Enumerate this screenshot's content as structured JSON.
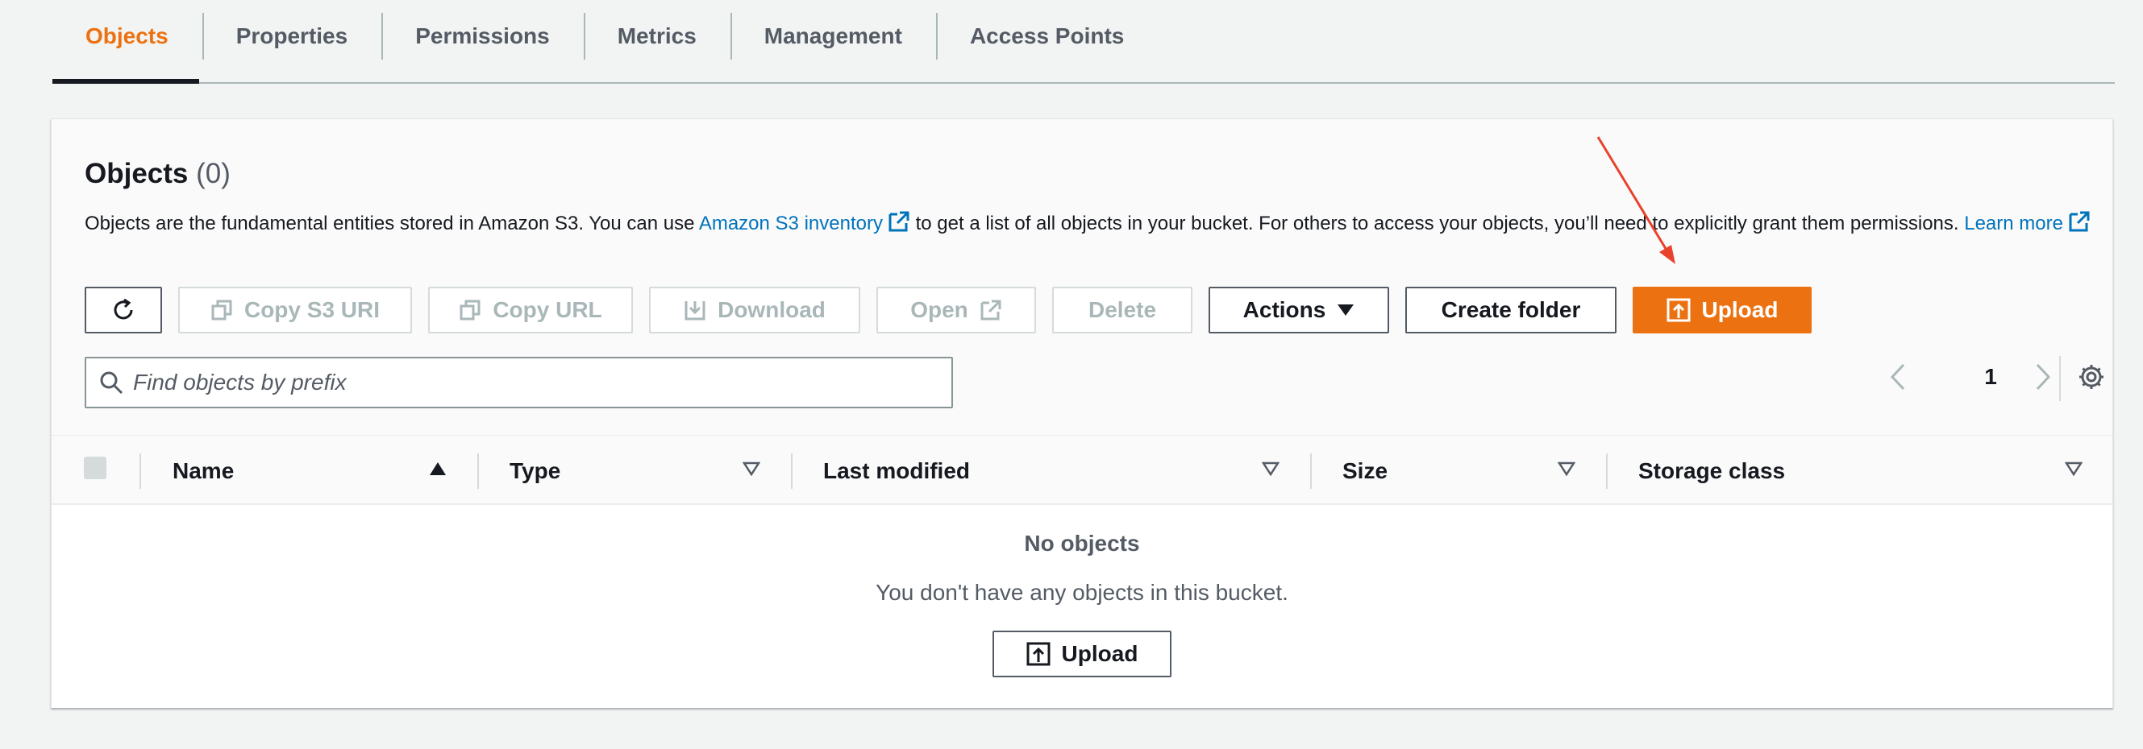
{
  "tabs": [
    {
      "label": "Objects",
      "active": true
    },
    {
      "label": "Properties",
      "active": false
    },
    {
      "label": "Permissions",
      "active": false
    },
    {
      "label": "Metrics",
      "active": false
    },
    {
      "label": "Management",
      "active": false
    },
    {
      "label": "Access Points",
      "active": false
    }
  ],
  "panel": {
    "title": "Objects",
    "count": "(0)",
    "description": {
      "text_before": "Objects are the fundamental entities stored in Amazon S3. You can use ",
      "inventory_link": "Amazon S3 inventory",
      "text_after": " to get a list of all objects in your bucket. For others to access your objects, you’ll need to explicitly grant them permissions. ",
      "learn_more_link": "Learn more"
    }
  },
  "toolbar": {
    "copy_s3_uri": "Copy S3 URI",
    "copy_url": "Copy URL",
    "download": "Download",
    "open": "Open",
    "delete": "Delete",
    "actions": "Actions",
    "create_folder": "Create folder",
    "upload": "Upload"
  },
  "search": {
    "placeholder": "Find objects by prefix",
    "value": ""
  },
  "pagination": {
    "current_page": "1"
  },
  "table": {
    "columns": [
      {
        "label": "Name",
        "sort": "ascending"
      },
      {
        "label": "Type",
        "sort": "none"
      },
      {
        "label": "Last modified",
        "sort": "none"
      },
      {
        "label": "Size",
        "sort": "none"
      },
      {
        "label": "Storage class",
        "sort": "none"
      }
    ],
    "empty_title": "No objects",
    "empty_text": "You don't have any objects in this bucket.",
    "empty_upload": "Upload"
  },
  "colors": {
    "accent_orange": "#ec7211",
    "link_blue": "#0073bb",
    "annotation_red": "#e8412c",
    "text_dark": "#16191f",
    "text_grey": "#545b64",
    "disabled": "#aab7b8"
  },
  "icons": {
    "refresh": "refresh-icon",
    "copy": "copy-icon",
    "download": "download-icon",
    "external_link": "external-link-icon",
    "caret_down": "caret-down-icon",
    "upload": "upload-icon",
    "search": "search-icon",
    "chevron_left": "chevron-left-icon",
    "chevron_right": "chevron-right-icon",
    "settings": "gear-icon"
  }
}
